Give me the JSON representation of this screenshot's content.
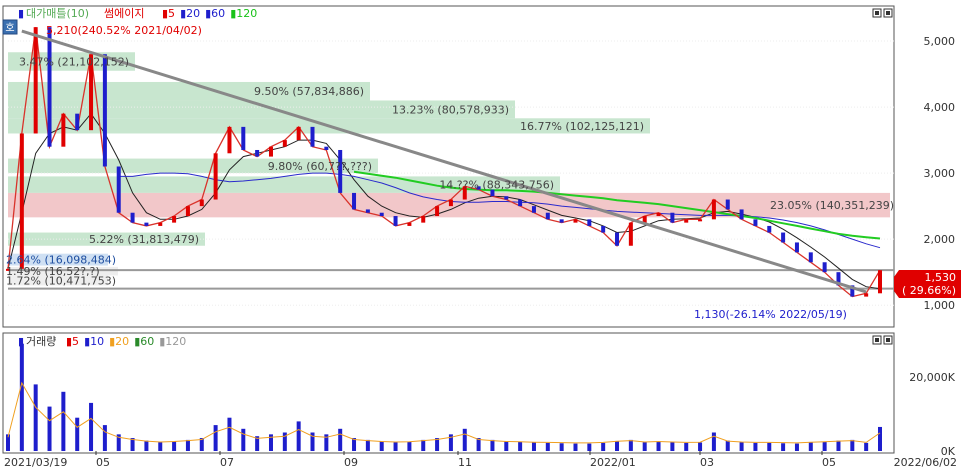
{
  "price_panel": {
    "legend_symbol": "▮",
    "name": "대가매틀(10)",
    "indicator_name": "썸에이지",
    "ma_labels": [
      "5",
      "20",
      "60",
      "120"
    ],
    "ma_colors": [
      "#e00000",
      "#1e1ecc",
      "#1e1ecc",
      "#19c219"
    ],
    "tag": "호",
    "max_label": "5,210(240.52% 2021/04/02)",
    "min_label": "1,130(-26.14% 2022/05/19)",
    "current_price": "1,530",
    "current_change": "( 29.66%)",
    "y_axis_ticks": [
      "5,000",
      "4,000",
      "3,000",
      "2,000",
      "1,000"
    ]
  },
  "volume_panel": {
    "name": "거래량",
    "ma_labels": [
      "5",
      "10",
      "20",
      "60",
      "120"
    ],
    "ma_colors": [
      "#e00000",
      "#1e1ecc",
      "#f0a020",
      "#2a8a2a",
      "#999999"
    ],
    "y_axis_ticks": [
      "20,000K",
      "0K"
    ]
  },
  "x_axis": {
    "start_date": "2021/03/19",
    "end_date": "2022/06/02",
    "ticks": [
      "05",
      "07",
      "09",
      "11",
      "2022/01",
      "03",
      "05"
    ]
  },
  "volume_profile": [
    {
      "label": "3.47% (21,102,152)",
      "color": "green"
    },
    {
      "label": "9.50% (57,834,886)",
      "color": "green"
    },
    {
      "label": "13.23% (80,578,933)",
      "color": "green"
    },
    {
      "label": "16.77% (102,125,121)",
      "color": "green"
    },
    {
      "label": "9.80% (60,7??,???)",
      "color": "green"
    },
    {
      "label": "14.??% (88,343,756)",
      "color": "green"
    },
    {
      "label": "23.05% (140,351,239)",
      "color": "red"
    },
    {
      "label": "5.22% (31,813,479)",
      "color": "green"
    },
    {
      "label": "2.64% (16,098,484)",
      "color": "blue"
    },
    {
      "label": "1.49% (16,52?,?)",
      "color": "gray"
    },
    {
      "label": "1.72% (10,471,753)",
      "color": "gray"
    }
  ],
  "chart_data": {
    "type": "line",
    "x": [
      "2021/03/19",
      "2021/03/26",
      "2021/04/02",
      "2021/04/09",
      "2021/04/16",
      "2021/04/23",
      "2021/04/30",
      "2021/05/07",
      "2021/05/14",
      "2021/05/21",
      "2021/05/28",
      "2021/06/04",
      "2021/06/11",
      "2021/06/18",
      "2021/06/25",
      "2021/07/02",
      "2021/07/09",
      "2021/07/16",
      "2021/07/23",
      "2021/07/30",
      "2021/08/06",
      "2021/08/13",
      "2021/08/20",
      "2021/08/27",
      "2021/09/03",
      "2021/09/10",
      "2021/09/17",
      "2021/09/24",
      "2021/10/01",
      "2021/10/08",
      "2021/10/15",
      "2021/10/22",
      "2021/10/29",
      "2021/11/05",
      "2021/11/12",
      "2021/11/19",
      "2021/11/26",
      "2021/12/03",
      "2021/12/10",
      "2021/12/17",
      "2021/12/24",
      "2021/12/31",
      "2022/01/07",
      "2022/01/14",
      "2022/01/21",
      "2022/01/28",
      "2022/02/04",
      "2022/02/11",
      "2022/02/18",
      "2022/02/25",
      "2022/03/04",
      "2022/03/11",
      "2022/03/18",
      "2022/03/25",
      "2022/04/01",
      "2022/04/08",
      "2022/04/15",
      "2022/04/22",
      "2022/04/29",
      "2022/05/06",
      "2022/05/13",
      "2022/05/19",
      "2022/05/27",
      "2022/06/02"
    ],
    "series": [
      {
        "values": [
          1550,
          3600,
          5210,
          3400,
          3900,
          3650,
          4800,
          3100,
          2400,
          2250,
          2200,
          2250,
          2350,
          2500,
          2600,
          3300,
          3700,
          3350,
          3250,
          3400,
          3500,
          3700,
          3400,
          3350,
          2700,
          2450,
          2400,
          2350,
          2200,
          2250,
          2350,
          2500,
          2600,
          2800,
          2750,
          2650,
          2600,
          2500,
          2400,
          2300,
          2250,
          2300,
          2200,
          2100,
          1900,
          2250,
          2350,
          2400,
          2250,
          2300,
          2300,
          2600,
          2450,
          2300,
          2200,
          2100,
          1950,
          1800,
          1650,
          1500,
          1300,
          1130,
          1180,
          1530
        ]
      },
      {
        "values": [
          1550,
          2400,
          3300,
          3600,
          3700,
          3650,
          3900,
          3600,
          3200,
          2700,
          2400,
          2300,
          2300,
          2350,
          2450,
          2700,
          3050,
          3250,
          3300,
          3350,
          3400,
          3500,
          3500,
          3450,
          3200,
          2900,
          2650,
          2500,
          2400,
          2350,
          2330,
          2380,
          2450,
          2550,
          2620,
          2650,
          2640,
          2600,
          2520,
          2440,
          2360,
          2320,
          2280,
          2200,
          2100,
          2120,
          2200,
          2280,
          2300,
          2310,
          2320,
          2400,
          2420,
          2380,
          2330,
          2260,
          2150,
          2020,
          1880,
          1730,
          1560,
          1390,
          1280,
          1250
        ]
      },
      {
        "values": [
          null,
          null,
          null,
          null,
          null,
          null,
          null,
          null,
          2950,
          2950,
          2980,
          3000,
          3000,
          2990,
          2950,
          2900,
          2870,
          2880,
          2900,
          2920,
          2950,
          2980,
          3000,
          3000,
          2980,
          2950,
          2900,
          2850,
          2780,
          2700,
          2640,
          2600,
          2570,
          2560,
          2560,
          2570,
          2570,
          2560,
          2550,
          2530,
          2500,
          2480,
          2460,
          2440,
          2420,
          2410,
          2400,
          2390,
          2380,
          2370,
          2360,
          2360,
          2360,
          2350,
          2340,
          2320,
          2290,
          2250,
          2200,
          2140,
          2070,
          2000,
          1930,
          1870
        ]
      },
      {
        "values": [
          null,
          null,
          null,
          null,
          null,
          null,
          null,
          null,
          null,
          null,
          null,
          null,
          null,
          null,
          null,
          null,
          null,
          null,
          null,
          null,
          null,
          null,
          null,
          null,
          null,
          3020,
          2990,
          2960,
          2930,
          2890,
          2850,
          2810,
          2780,
          2760,
          2750,
          2740,
          2740,
          2730,
          2720,
          2700,
          2680,
          2660,
          2640,
          2620,
          2590,
          2570,
          2550,
          2530,
          2500,
          2470,
          2440,
          2410,
          2380,
          2350,
          2320,
          2280,
          2240,
          2200,
          2160,
          2120,
          2080,
          2050,
          2030,
          2010
        ]
      }
    ],
    "trendline": {
      "from": [
        "2021/03/26",
        5150
      ],
      "to": [
        "2022/05/27",
        1200
      ]
    },
    "hlines": [
      1530,
      1250
    ],
    "volume": [
      4500,
      29000,
      18000,
      12000,
      16000,
      9000,
      13000,
      7000,
      4500,
      3500,
      2800,
      2400,
      2600,
      3000,
      3500,
      7000,
      9000,
      6000,
      4000,
      4500,
      5000,
      8000,
      5000,
      4500,
      6000,
      3500,
      3000,
      2600,
      2400,
      2500,
      3000,
      3500,
      4500,
      6000,
      3500,
      3000,
      2600,
      2500,
      2300,
      2200,
      2100,
      2000,
      2000,
      2200,
      2700,
      3000,
      2400,
      2600,
      2400,
      2200,
      2300,
      5000,
      2800,
      2400,
      2200,
      2200,
      2100,
      2000,
      2300,
      2500,
      2800,
      3000,
      2200,
      6500
    ],
    "ylim": [
      700,
      5500
    ],
    "volume_ylim": [
      0,
      30000
    ]
  }
}
